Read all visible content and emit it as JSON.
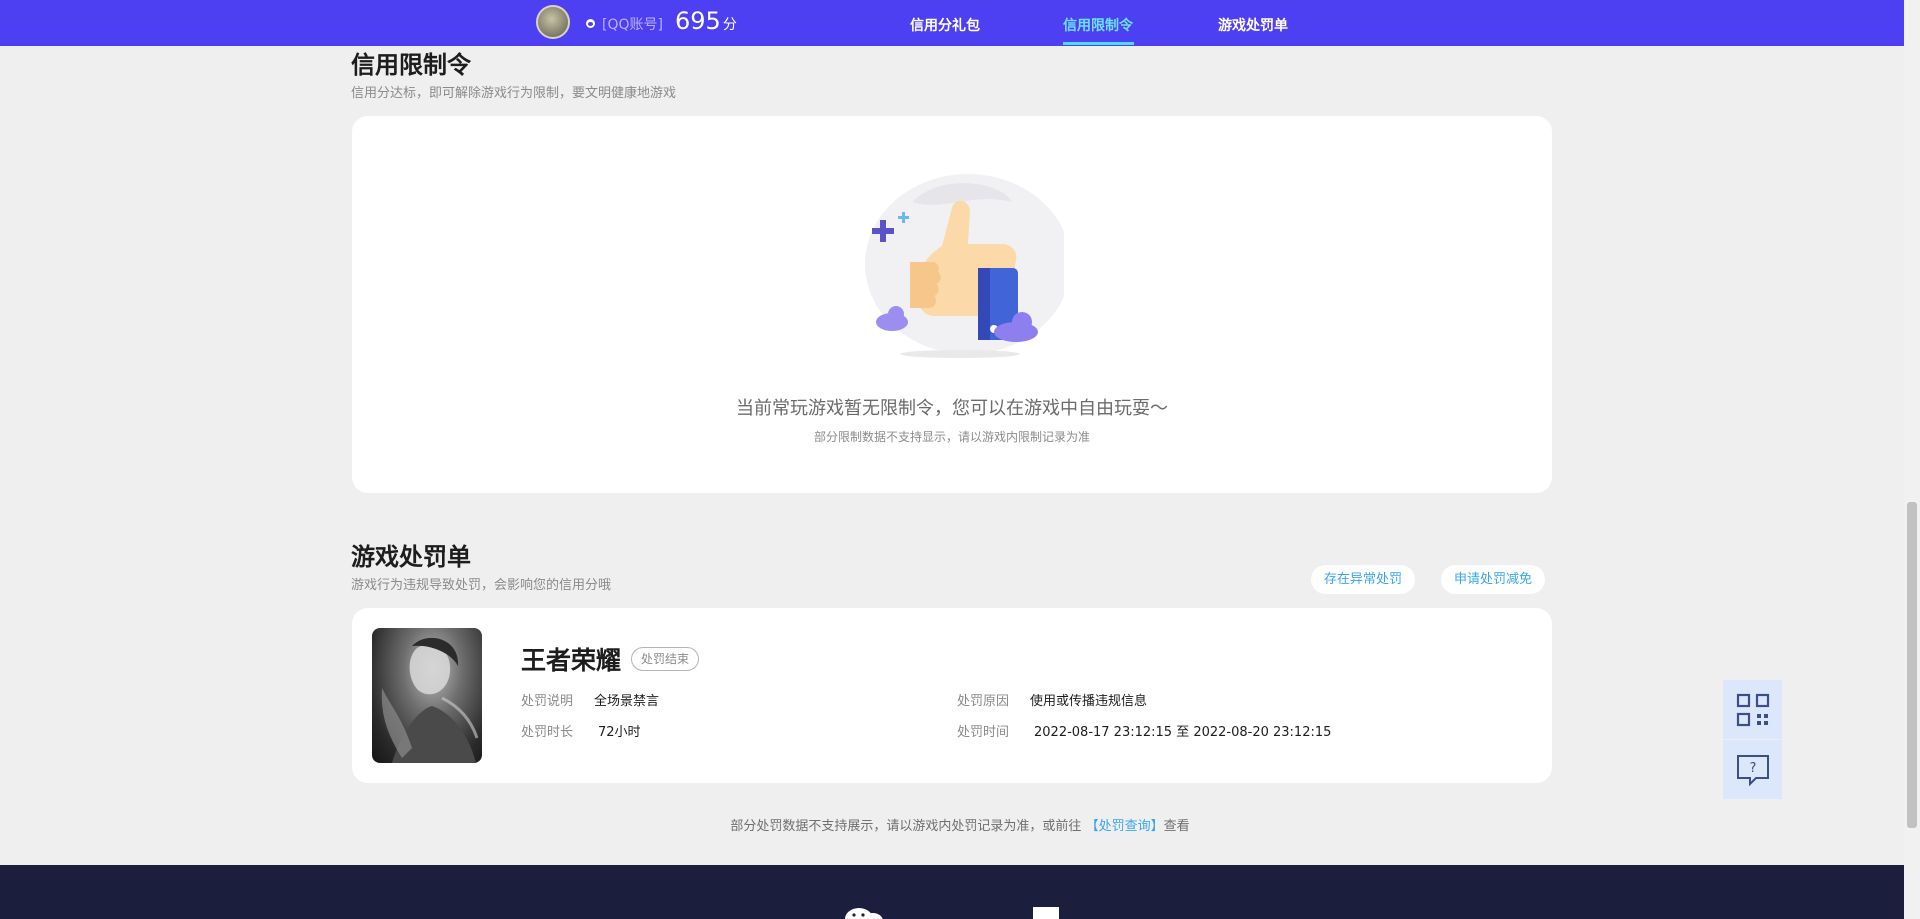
{
  "header": {
    "account_label": "[QQ账号]",
    "score": "695",
    "score_unit": "分",
    "tabs": [
      {
        "label": "信用分礼包"
      },
      {
        "label": "信用限制令"
      },
      {
        "label": "游戏处罚单"
      }
    ],
    "active_tab": "信用限制令"
  },
  "restriction": {
    "title": "信用限制令",
    "subtitle": "信用分达标，即可解除游戏行为限制，要文明健康地游戏",
    "empty_message": "当前常玩游戏暂无限制令，您可以在游戏中自由玩耍～",
    "empty_note": "部分限制数据不支持显示，请以游戏内限制记录为准"
  },
  "penalty": {
    "title": "游戏处罚单",
    "subtitle": "游戏行为违规导致处罚，会影响您的信用分哦",
    "buttons": [
      {
        "label": "存在异常处罚"
      },
      {
        "label": "申请处罚减免"
      }
    ],
    "record": {
      "game_name": "王者荣耀",
      "status": "处罚结束",
      "fields": [
        {
          "label": "处罚说明",
          "value": "全场景禁言"
        },
        {
          "label": "处罚原因",
          "value": "使用或传播违规信息"
        },
        {
          "label": "处罚时长",
          "value": "72小时"
        },
        {
          "label": "处罚时间",
          "value": "2022-08-17 23:12:15 至 2022-08-20 23:12:15"
        }
      ]
    },
    "footnote_prefix": "部分处罚数据不支持展示，请以游戏内处罚记录为准，或前往",
    "footnote_link": "【处罚查询】",
    "footnote_suffix": "查看"
  },
  "side": {
    "qr_icon": "qr-code-icon",
    "help_icon": "help-chat-icon"
  },
  "colors": {
    "nav_bg": "#4d3ff2",
    "nav_active": "#6ae1ff",
    "link": "#3aa5ef",
    "footer_bg": "#1c1e3d",
    "page_bg": "#efefef"
  }
}
